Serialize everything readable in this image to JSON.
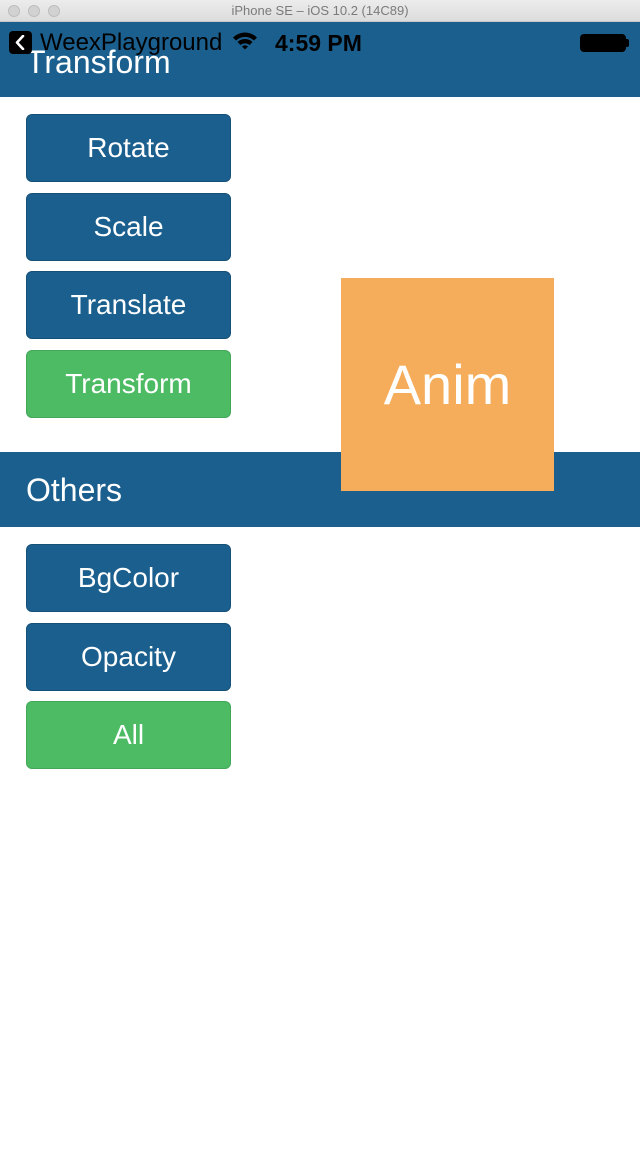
{
  "simulator": {
    "title": "iPhone SE – iOS 10.2 (14C89)"
  },
  "status_bar": {
    "app_name": "WeexPlayground",
    "time": "4:59 PM"
  },
  "sections": {
    "transform": {
      "title": "Transform",
      "buttons": [
        "Rotate",
        "Scale",
        "Translate",
        "Transform"
      ]
    },
    "others": {
      "title": "Others",
      "buttons": [
        "BgColor",
        "Opacity",
        "All"
      ]
    }
  },
  "anim_box": {
    "label": "Anim"
  },
  "colors": {
    "header_blue": "#1b5f8e",
    "button_blue": "#1b5f8e",
    "button_green": "#4dbb63",
    "anim_orange": "#f5ad5b"
  },
  "icons": [
    "back-icon",
    "wifi-icon",
    "battery-icon"
  ]
}
